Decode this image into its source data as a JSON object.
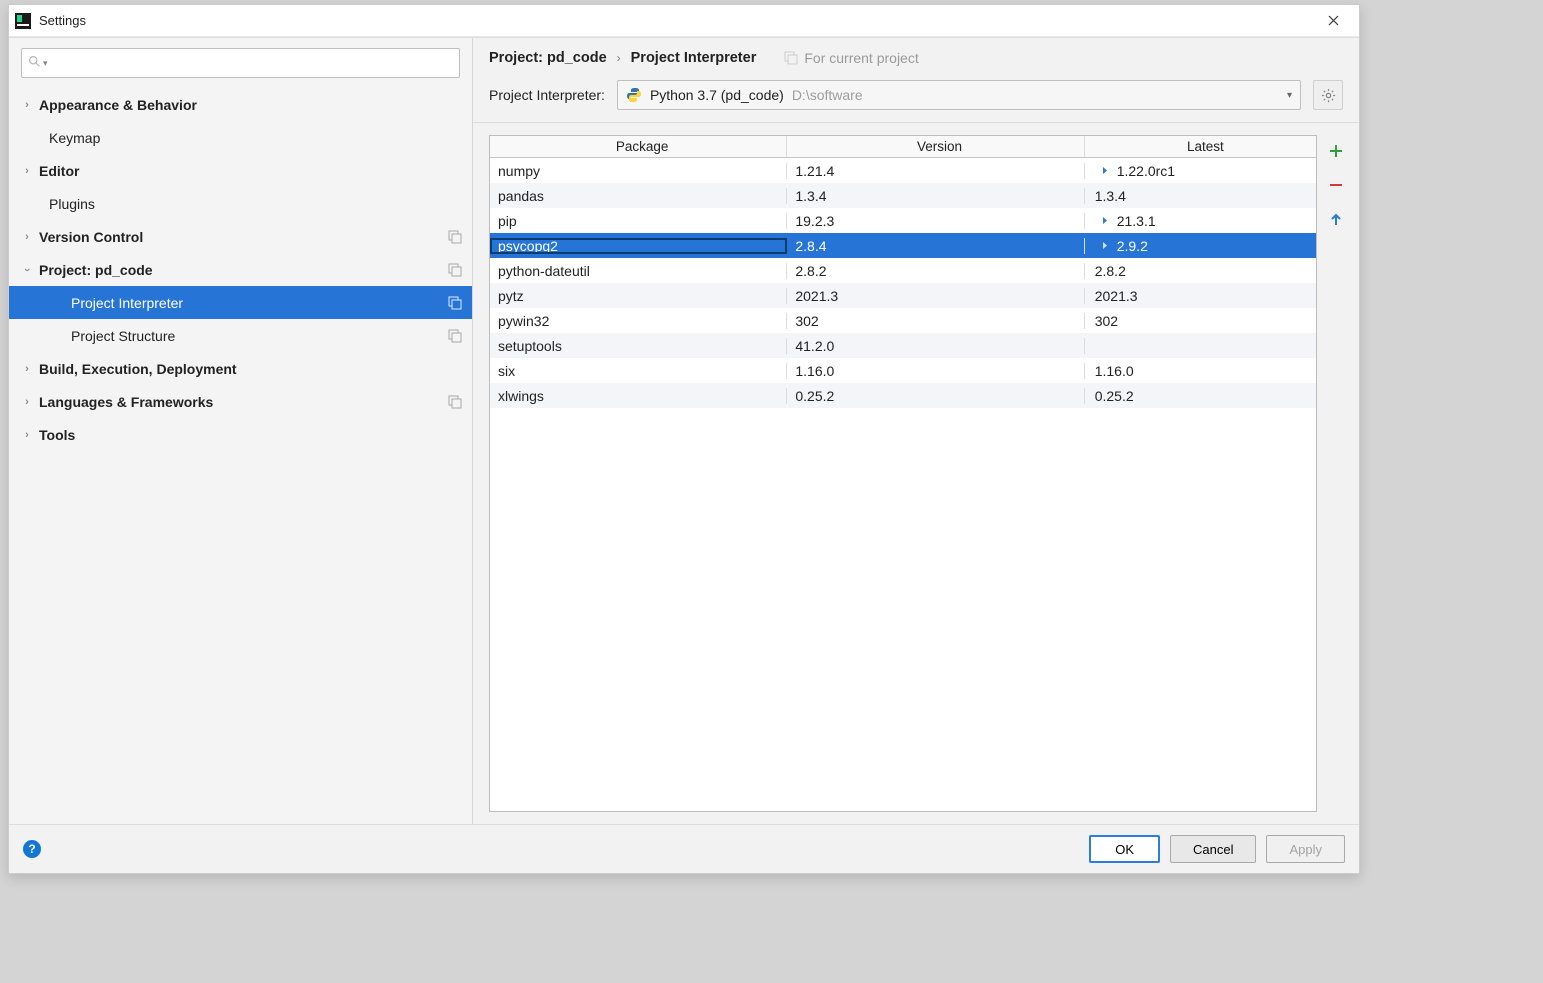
{
  "window": {
    "title": "Settings"
  },
  "search": {
    "placeholder": ""
  },
  "tree": [
    {
      "label": "Appearance & Behavior"
    },
    {
      "label": "Keymap"
    },
    {
      "label": "Editor"
    },
    {
      "label": "Plugins"
    },
    {
      "label": "Version Control"
    },
    {
      "label": "Project: pd_code"
    },
    {
      "label": "Project Interpreter"
    },
    {
      "label": "Project Structure"
    },
    {
      "label": "Build, Execution, Deployment"
    },
    {
      "label": "Languages & Frameworks"
    },
    {
      "label": "Tools"
    }
  ],
  "breadcrumb": {
    "project": "Project: pd_code",
    "page": "Project Interpreter",
    "hint": "For current project"
  },
  "interpreter": {
    "label": "Project Interpreter:",
    "name": "Python 3.7 (pd_code)",
    "path": "D:\\software"
  },
  "packages": {
    "columns": [
      "Package",
      "Version",
      "Latest"
    ],
    "rows": [
      {
        "name": "numpy",
        "version": "1.21.4",
        "latest": "1.22.0rc1",
        "update": true,
        "selected": false
      },
      {
        "name": "pandas",
        "version": "1.3.4",
        "latest": "1.3.4",
        "update": false,
        "selected": false
      },
      {
        "name": "pip",
        "version": "19.2.3",
        "latest": "21.3.1",
        "update": true,
        "selected": false
      },
      {
        "name": "psycopg2",
        "version": "2.8.4",
        "latest": "2.9.2",
        "update": true,
        "selected": true
      },
      {
        "name": "python-dateutil",
        "version": "2.8.2",
        "latest": "2.8.2",
        "update": false,
        "selected": false
      },
      {
        "name": "pytz",
        "version": "2021.3",
        "latest": "2021.3",
        "update": false,
        "selected": false
      },
      {
        "name": "pywin32",
        "version": "302",
        "latest": "302",
        "update": false,
        "selected": false
      },
      {
        "name": "setuptools",
        "version": "41.2.0",
        "latest": "",
        "update": false,
        "selected": false
      },
      {
        "name": "six",
        "version": "1.16.0",
        "latest": "1.16.0",
        "update": false,
        "selected": false
      },
      {
        "name": "xlwings",
        "version": "0.25.2",
        "latest": "0.25.2",
        "update": false,
        "selected": false
      }
    ]
  },
  "buttons": {
    "ok": "OK",
    "cancel": "Cancel",
    "apply": "Apply"
  }
}
